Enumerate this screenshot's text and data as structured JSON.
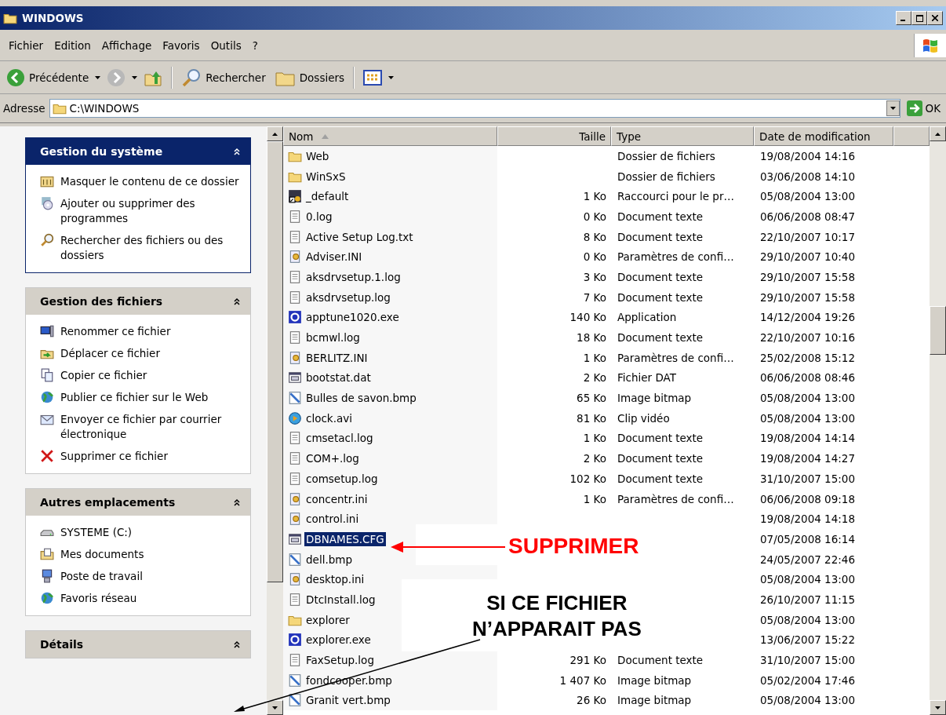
{
  "window": {
    "title": "WINDOWS"
  },
  "menu": [
    "Fichier",
    "Edition",
    "Affichage",
    "Favoris",
    "Outils",
    "?"
  ],
  "toolbar": {
    "back": "Précédente",
    "search": "Rechercher",
    "folders": "Dossiers"
  },
  "address": {
    "label": "Adresse",
    "value": "C:\\WINDOWS",
    "go": "OK"
  },
  "sections": [
    {
      "title": "Gestion du système",
      "kind": "special",
      "items": [
        {
          "label": "Masquer le contenu de ce dossier",
          "kind": "window"
        },
        {
          "label": "Ajouter ou supprimer des programmes",
          "kind": "cd"
        },
        {
          "label": "Rechercher des fichiers ou des dossiers",
          "kind": "search"
        }
      ]
    },
    {
      "title": "Gestion des fichiers",
      "kind": "normal",
      "items": [
        {
          "label": "Renommer ce fichier",
          "kind": "monitor"
        },
        {
          "label": "Déplacer ce fichier",
          "kind": "move"
        },
        {
          "label": "Copier ce fichier",
          "kind": "copy"
        },
        {
          "label": "Publier ce fichier sur le Web",
          "kind": "globe"
        },
        {
          "label": "Envoyer ce fichier par courrier électronique",
          "kind": "mail"
        },
        {
          "label": "Supprimer ce fichier",
          "kind": "delete"
        }
      ]
    },
    {
      "title": "Autres emplacements",
      "kind": "normal",
      "items": [
        {
          "label": "SYSTEME (C:)",
          "kind": "drive"
        },
        {
          "label": "Mes documents",
          "kind": "docs"
        },
        {
          "label": "Poste de travail",
          "kind": "computer"
        },
        {
          "label": "Favoris réseau",
          "kind": "globe"
        }
      ]
    },
    {
      "title": "Détails",
      "kind": "normal"
    }
  ],
  "columns": [
    {
      "label": "Nom",
      "sorted": true
    },
    {
      "label": "Taille",
      "sorted": false
    },
    {
      "label": "Type",
      "sorted": false
    },
    {
      "label": "Date de modification",
      "sorted": false
    }
  ],
  "rows": [
    {
      "name": "Web",
      "type": "Dossier de fichiers",
      "date": "19/08/2004 14:16",
      "kind": "folder",
      "selected": false
    },
    {
      "name": "WinSxS",
      "type": "Dossier de fichiers",
      "date": "03/06/2008 14:10",
      "kind": "folder",
      "selected": false
    },
    {
      "name": "_default",
      "size": "1 Ko",
      "type": "Raccourci pour le pr…",
      "date": "05/08/2004 13:00",
      "kind": "shortcut",
      "selected": false
    },
    {
      "name": "0.log",
      "size": "0 Ko",
      "type": "Document texte",
      "date": "06/06/2008 08:47",
      "kind": "text",
      "selected": false
    },
    {
      "name": "Active Setup Log.txt",
      "size": "8 Ko",
      "type": "Document texte",
      "date": "22/10/2007 10:17",
      "kind": "text",
      "selected": false
    },
    {
      "name": "Adviser.INI",
      "size": "0 Ko",
      "type": "Paramètres de confi…",
      "date": "29/10/2007 10:40",
      "kind": "ini",
      "selected": false
    },
    {
      "name": "aksdrvsetup.1.log",
      "size": "3 Ko",
      "type": "Document texte",
      "date": "29/10/2007 15:58",
      "kind": "text",
      "selected": false
    },
    {
      "name": "aksdrvsetup.log",
      "size": "7 Ko",
      "type": "Document texte",
      "date": "29/10/2007 15:58",
      "kind": "text",
      "selected": false
    },
    {
      "name": "apptune1020.exe",
      "size": "140 Ko",
      "type": "Application",
      "date": "14/12/2004 19:26",
      "kind": "exe",
      "selected": false
    },
    {
      "name": "bcmwl.log",
      "size": "18 Ko",
      "type": "Document texte",
      "date": "22/10/2007 10:16",
      "kind": "text",
      "selected": false
    },
    {
      "name": "BERLITZ.INI",
      "size": "1 Ko",
      "type": "Paramètres de confi…",
      "date": "25/02/2008 15:12",
      "kind": "ini",
      "selected": false
    },
    {
      "name": "bootstat.dat",
      "size": "2 Ko",
      "type": "Fichier DAT",
      "date": "06/06/2008 08:46",
      "kind": "dat",
      "selected": false
    },
    {
      "name": "Bulles de savon.bmp",
      "size": "65 Ko",
      "type": "Image bitmap",
      "date": "05/08/2004 13:00",
      "kind": "bmp",
      "selected": false
    },
    {
      "name": "clock.avi",
      "size": "81 Ko",
      "type": "Clip vidéo",
      "date": "05/08/2004 13:00",
      "kind": "avi",
      "selected": false
    },
    {
      "name": "cmsetacl.log",
      "size": "1 Ko",
      "type": "Document texte",
      "date": "19/08/2004 14:14",
      "kind": "text",
      "selected": false
    },
    {
      "name": "COM+.log",
      "size": "2 Ko",
      "type": "Document texte",
      "date": "19/08/2004 14:27",
      "kind": "text",
      "selected": false
    },
    {
      "name": "comsetup.log",
      "size": "102 Ko",
      "type": "Document texte",
      "date": "31/10/2007 15:00",
      "kind": "text",
      "selected": false
    },
    {
      "name": "concentr.ini",
      "size": "1 Ko",
      "type": "Paramètres de confi…",
      "date": "06/06/2008 09:18",
      "kind": "ini",
      "selected": false
    },
    {
      "name": "control.ini",
      "date": "19/08/2004 14:18",
      "kind": "ini",
      "selected": false
    },
    {
      "name": "DBNAMES.CFG",
      "date": "07/05/2008 16:14",
      "kind": "dat",
      "selected": true
    },
    {
      "name": "dell.bmp",
      "date": "24/05/2007 22:46",
      "kind": "bmp",
      "selected": false
    },
    {
      "name": "desktop.ini",
      "date": "05/08/2004 13:00",
      "kind": "ini",
      "selected": false
    },
    {
      "name": "DtcInstall.log",
      "date": "26/10/2007 11:15",
      "kind": "text",
      "selected": false
    },
    {
      "name": "explorer",
      "date": "05/08/2004 13:00",
      "kind": "folder",
      "selected": false
    },
    {
      "name": "explorer.exe",
      "date": "13/06/2007 15:22",
      "kind": "exe",
      "selected": false
    },
    {
      "name": "FaxSetup.log",
      "size": "291 Ko",
      "type": "Document texte",
      "date": "31/10/2007 15:00",
      "kind": "text",
      "selected": false
    },
    {
      "name": "fondcooper.bmp",
      "size": "1 407 Ko",
      "type": "Image bitmap",
      "date": "05/02/2004 17:46",
      "kind": "bmp",
      "selected": false
    },
    {
      "name": "Granit vert.bmp",
      "size": "26 Ko",
      "type": "Image bitmap",
      "date": "05/08/2004 13:00",
      "kind": "bmp",
      "selected": false
    }
  ],
  "annotations": {
    "callout": "SUPPRIMER",
    "note": [
      "SI CE FICHIER",
      "N’APPARAIT PAS"
    ]
  }
}
